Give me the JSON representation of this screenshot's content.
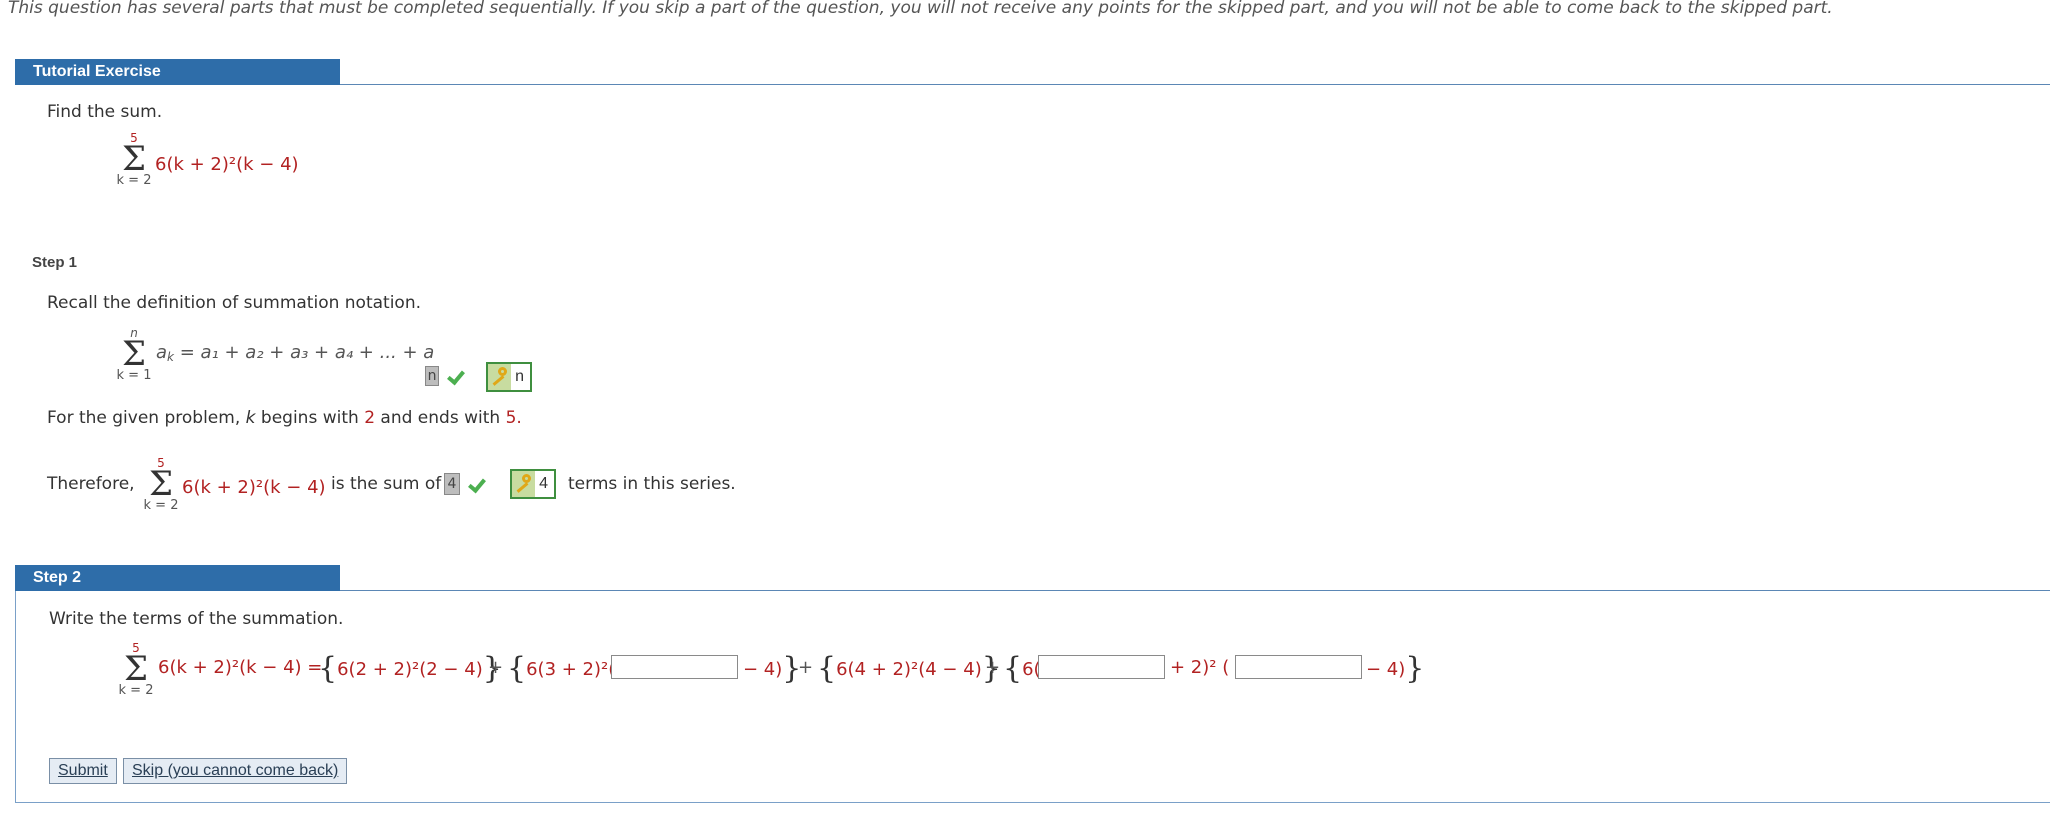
{
  "notice": "This question has several parts that must be completed sequentially. If you skip a part of the question, you will not receive any points for the skipped part, and you will not be able to come back to the skipped part.",
  "tutorial": {
    "header": "Tutorial Exercise",
    "prompt": "Find the sum.",
    "sum_upper": "5",
    "sum_lower": "k = 2",
    "term": "6(k + 2)²(k − 4)"
  },
  "step1": {
    "label": "Step 1",
    "recall": "Recall the definition of summation notation.",
    "def_upper": "n",
    "def_lower": "k = 1",
    "def_lhs": "a",
    "def_lhs_sub": "k",
    "def_rhs": "= a₁ + a₂ + a₃ + a₄ + ... + a",
    "answer_entered": "n",
    "answer_key": "n",
    "given_prefix": "For the given problem,",
    "given_k": "k",
    "given_mid1": "begins with",
    "given_start": "2",
    "given_mid2": "and ends with",
    "given_end": "5.",
    "therefore": "Therefore,",
    "sum_upper": "5",
    "sum_lower": "k = 2",
    "term": "6(k + 2)²(k − 4)",
    "is_sum_of": "is the sum of",
    "count_entered": "4",
    "count_key": "4",
    "terms_suffix": "terms in this series."
  },
  "step2": {
    "label": "Step 2",
    "instruction": "Write the terms of the summation.",
    "sum_upper": "5",
    "sum_lower": "k = 2",
    "lhs": "6(k + 2)²(k − 4) =",
    "t1": "6(2 + 2)²(2 − 4)",
    "plus": "+",
    "t2_pre": "6(3 + 2)²(",
    "t2_post": "− 4)",
    "t3": "6(4 + 2)²(4 − 4)",
    "t4_pre": "6(",
    "t4_mid": "+ 2)² (",
    "t4_post": "− 4)",
    "input1": "",
    "input2": "",
    "input3": ""
  },
  "buttons": {
    "submit": "Submit",
    "skip": "Skip (you cannot come back)"
  }
}
